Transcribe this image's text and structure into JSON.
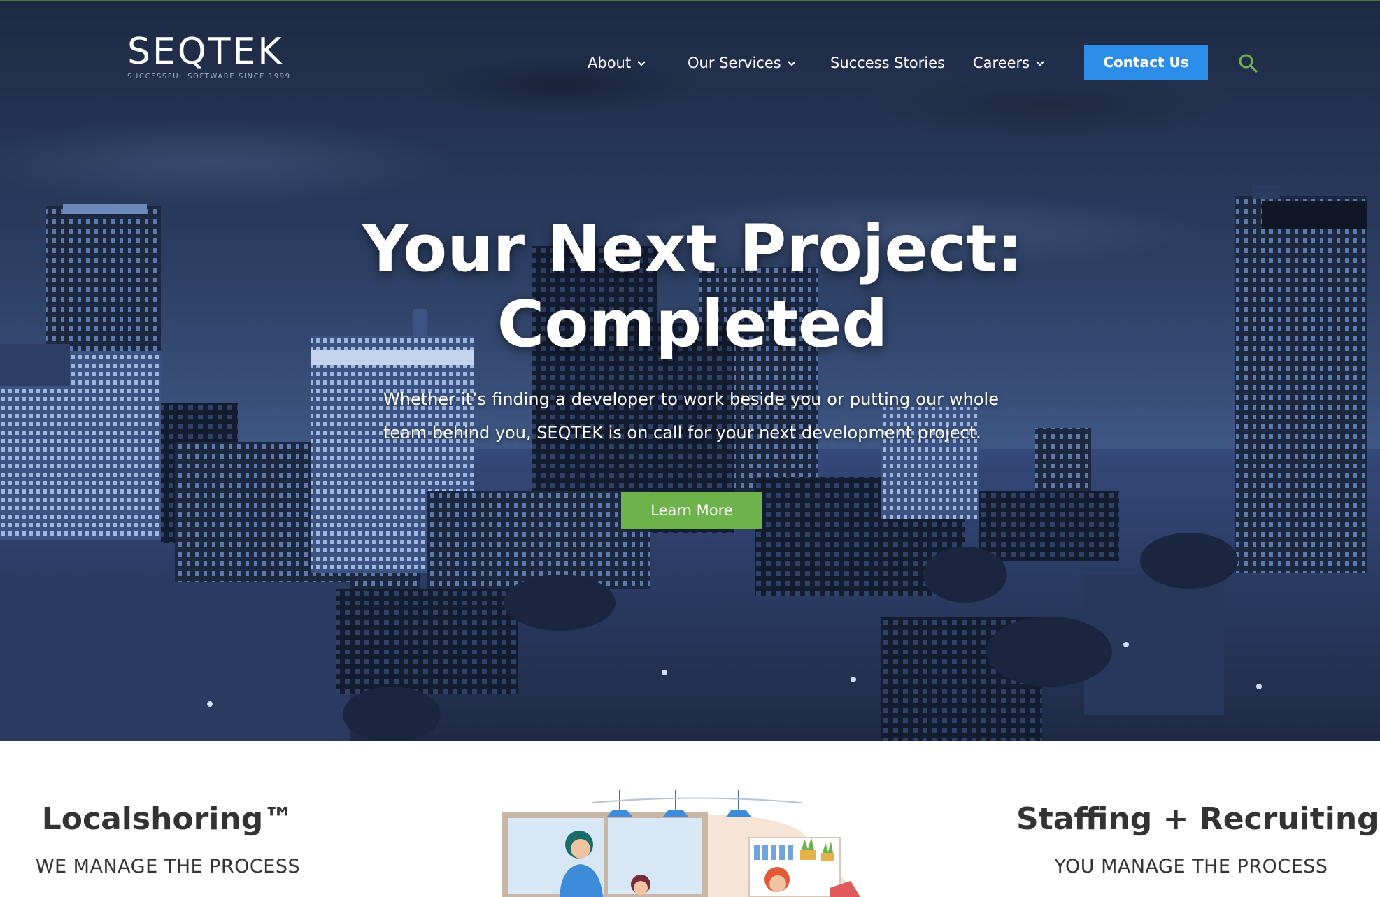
{
  "header": {
    "logo_text": "SEQTEK",
    "logo_tagline": "SUCCESSFUL SOFTWARE SINCE 1999",
    "nav": [
      {
        "label": "About",
        "has_dropdown": true
      },
      {
        "label": "Our Services",
        "has_dropdown": true
      },
      {
        "label": "Success Stories",
        "has_dropdown": false
      },
      {
        "label": "Careers",
        "has_dropdown": true
      }
    ],
    "contact_label": "Contact Us",
    "search_icon": "search-icon"
  },
  "hero": {
    "title_line1": "Your Next Project:",
    "title_line2": "Completed",
    "subtitle": "Whether it’s finding a developer to work beside you or putting our whole team behind you, SEQTEK is on call for your next development project.",
    "cta_label": "Learn More"
  },
  "services": {
    "left": {
      "title": "Localshoring™",
      "subtitle": "WE MANAGE THE PROCESS"
    },
    "right": {
      "title": "Staffing + Recruiting",
      "subtitle": "YOU MANAGE THE PROCESS"
    }
  },
  "colors": {
    "contact_button": "#2b8de8",
    "learn_button": "#6db24a",
    "brand_green": "#6db24a",
    "hero_overlay": "#2b3d61",
    "heading_text": "#333333"
  }
}
